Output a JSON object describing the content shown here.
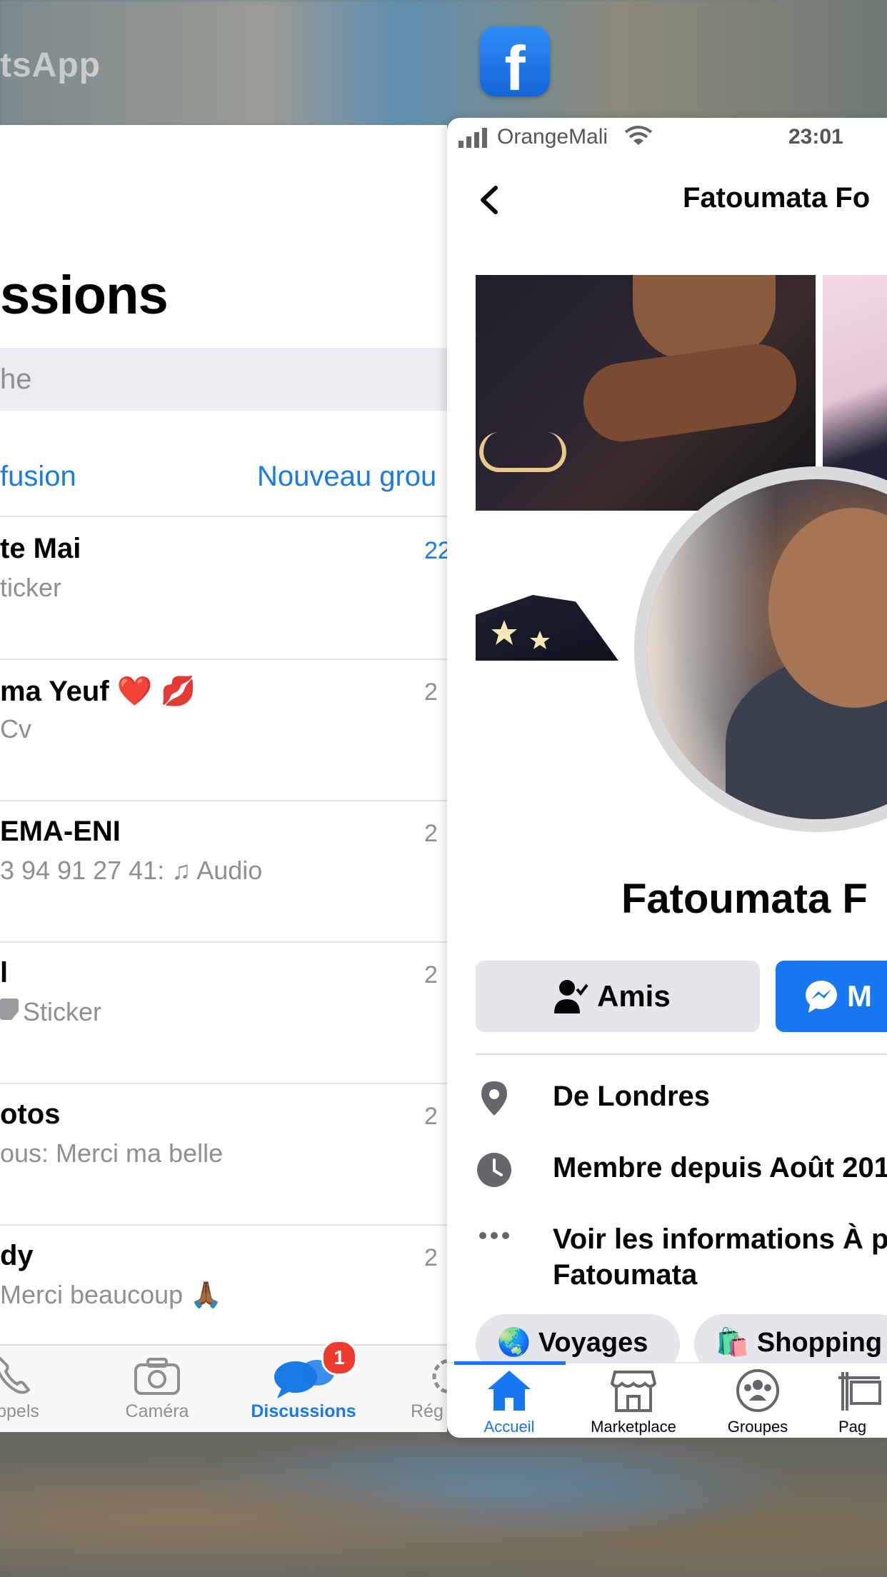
{
  "switcher": {
    "whatsapp_label": "tsApp",
    "facebook_icon_glyph": "f"
  },
  "whatsapp": {
    "title": "ssions",
    "search_placeholder": "he",
    "broadcast_link": "fusion",
    "new_group_link": "Nouveau grou",
    "chats": [
      {
        "name": "te Mai",
        "message": "ticker",
        "time": "22",
        "time_blue": true
      },
      {
        "name": "ma Yeuf ❤️ 💋",
        "message": "Cv",
        "time": "2"
      },
      {
        "name": "EMA-ENI",
        "message": "3 94 91 27 41: ♫ Audio",
        "time": "2"
      },
      {
        "name": "l",
        "message": "Sticker",
        "time": "2"
      },
      {
        "name": "otos",
        "message": "ous: Merci ma belle",
        "time": "2"
      },
      {
        "name": "dy",
        "message": "Merci beaucoup 🙏🏾",
        "time": "2"
      }
    ],
    "tabs": [
      {
        "label": "ppels",
        "icon": "phone-icon"
      },
      {
        "label": "Caméra",
        "icon": "camera-icon"
      },
      {
        "label": "Discussions",
        "icon": "chat-bubbles-icon",
        "badge": "1",
        "active": true
      },
      {
        "label": "Rég",
        "icon": "gear-icon"
      }
    ],
    "accent": "#1a7ae6"
  },
  "facebook": {
    "status": {
      "carrier": "OrangeMali",
      "time": "23:01"
    },
    "header_title": "Fatoumata Fo",
    "profile_name": "Fatoumata F",
    "friends_button": "Amis",
    "message_button": "M",
    "info": [
      {
        "icon": "location-pin-icon",
        "text": "De Londres"
      },
      {
        "icon": "clock-icon",
        "text": "Membre depuis Août 201"
      },
      {
        "icon": "more-dots-icon",
        "text": "Voir les informations À p",
        "text2": "Fatoumata"
      }
    ],
    "chips": [
      {
        "emoji": "🌏",
        "label": "Voyages"
      },
      {
        "emoji": "🛍️",
        "label": "Shopping"
      }
    ],
    "tabs": [
      {
        "label": "Accueil",
        "icon": "home-icon",
        "active": true
      },
      {
        "label": "Marketplace",
        "icon": "marketplace-icon"
      },
      {
        "label": "Groupes",
        "icon": "groups-icon"
      },
      {
        "label": "Pag",
        "icon": "pages-icon"
      }
    ],
    "accent": "#1877f2"
  }
}
